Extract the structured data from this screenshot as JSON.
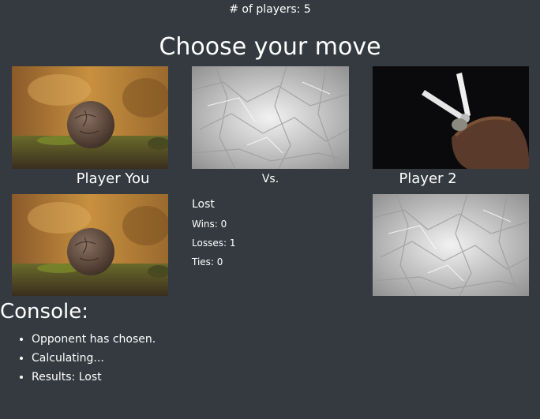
{
  "header": {
    "players_count": "# of players: 5"
  },
  "title": "Choose your move",
  "choices": [
    {
      "name": "Rock"
    },
    {
      "name": "Paper"
    },
    {
      "name": "Scissors"
    }
  ],
  "labels": {
    "player_you": "Player You",
    "versus": "Vs.",
    "player_two": "Player 2"
  },
  "result": {
    "status": "Lost",
    "wins": "Wins: 0",
    "losses": "Losses: 1",
    "ties": "Ties: 0"
  },
  "console": {
    "title": "Console:",
    "messages": [
      "Opponent has chosen.",
      "Calculating...",
      "Results: Lost"
    ]
  },
  "colors": {
    "background": "#343a40",
    "text": "#ffffff"
  }
}
